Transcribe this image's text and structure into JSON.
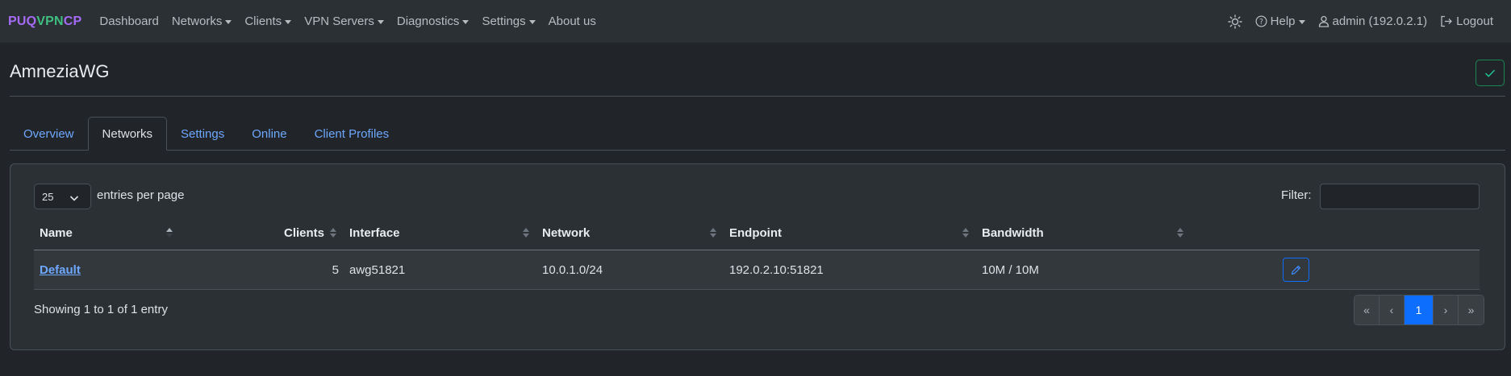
{
  "brand": {
    "part1": "PUQ",
    "part2": "VPN",
    "part3": "CP"
  },
  "nav": {
    "items": [
      {
        "label": "Dashboard",
        "dropdown": false
      },
      {
        "label": "Networks",
        "dropdown": true
      },
      {
        "label": "Clients",
        "dropdown": true
      },
      {
        "label": "VPN Servers",
        "dropdown": true
      },
      {
        "label": "Diagnostics",
        "dropdown": true
      },
      {
        "label": "Settings",
        "dropdown": true
      },
      {
        "label": "About us",
        "dropdown": false
      }
    ],
    "help": "Help",
    "user": "admin (192.0.2.1)",
    "logout": "Logout"
  },
  "page": {
    "title": "AmneziaWG"
  },
  "tabs": [
    {
      "label": "Overview",
      "active": false
    },
    {
      "label": "Networks",
      "active": true
    },
    {
      "label": "Settings",
      "active": false
    },
    {
      "label": "Online",
      "active": false
    },
    {
      "label": "Client Profiles",
      "active": false
    }
  ],
  "table": {
    "page_length": "25",
    "length_label": "entries per page",
    "filter_label": "Filter:",
    "columns": [
      "Name",
      "Clients",
      "Interface",
      "Network",
      "Endpoint",
      "Bandwidth"
    ],
    "rows": [
      {
        "name": "Default",
        "clients": "5",
        "interface": "awg51821",
        "network": "10.0.1.0/24",
        "endpoint": "192.0.2.10:51821",
        "bandwidth": "10M / 10M"
      }
    ],
    "info": "Showing 1 to 1 of 1 entry"
  },
  "pagination": {
    "first": "«",
    "prev": "‹",
    "current": "1",
    "next": "›",
    "last": "»"
  },
  "colors": {
    "accent": "#6ea8fe",
    "primary": "#0d6efd",
    "success": "#198754",
    "brand_purple": "#a66bf5",
    "brand_green": "#3fbf7f"
  }
}
